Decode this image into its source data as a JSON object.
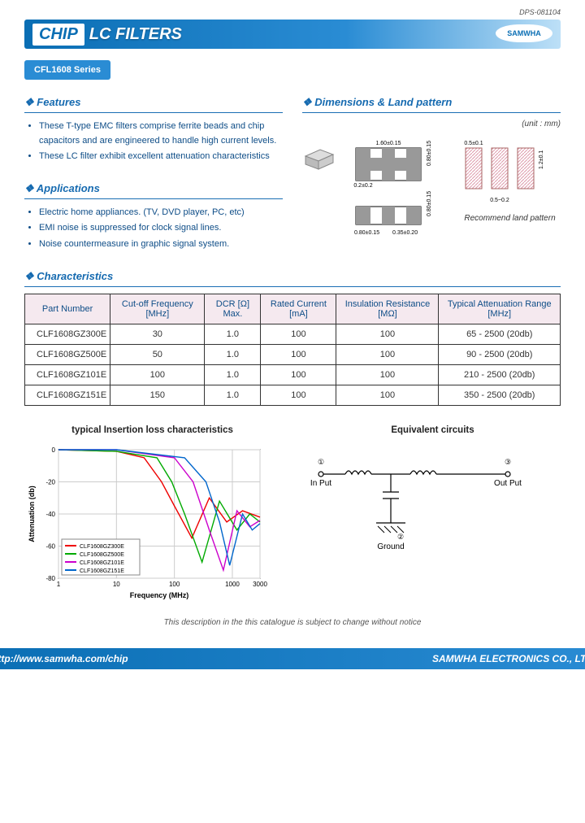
{
  "doc_number": "DPS-081104",
  "header": {
    "chip": "CHIP",
    "title": "LC FILTERS",
    "brand": "SAMWHA"
  },
  "series": "CFL1608 Series",
  "features_title": "Features",
  "features": [
    "These T-type EMC filters comprise ferrite beads and chip capacitors and are engineered to handle high current levels.",
    "These LC filter exhibit excellent attenuation characteristics"
  ],
  "applications_title": "Applications",
  "applications": [
    "Electric home appliances. (TV, DVD player, PC, etc)",
    "EMI noise is suppressed for clock signal lines.",
    "Noise countermeasure in graphic signal system."
  ],
  "dimensions_title": "Dimensions & Land pattern",
  "unit_note": "(unit : mm)",
  "dim_labels": {
    "w": "1.60±0.15",
    "h": "0.80±0.15",
    "t1": "0.2±0.2",
    "pad_w": "0.5±0.1",
    "pad_gap": "0.5~0.2",
    "land_h": "1.2±0.1",
    "bot_w": "0.80±0.15",
    "bot_t": "0.80±0.15",
    "bot_pad": "0.35±0.20"
  },
  "land_caption": "Recommend land pattern",
  "characteristics_title": "Characteristics",
  "table": {
    "headers": [
      "Part Number",
      "Cut-off Frequency [MHz]",
      "DCR [Ω] Max.",
      "Rated Current [mA]",
      "Insulation Resistance [MΩ]",
      "Typical Attenuation Range [MHz]"
    ],
    "rows": [
      [
        "CLF1608GZ300E",
        "30",
        "1.0",
        "100",
        "100",
        "65 - 2500 (20db)"
      ],
      [
        "CLF1608GZ500E",
        "50",
        "1.0",
        "100",
        "100",
        "90 - 2500 (20db)"
      ],
      [
        "CLF1608GZ101E",
        "100",
        "1.0",
        "100",
        "100",
        "210 - 2500 (20db)"
      ],
      [
        "CLF1608GZ151E",
        "150",
        "1.0",
        "100",
        "100",
        "350 - 2500 (20db)"
      ]
    ]
  },
  "chart_title": "typical Insertion loss characteristics",
  "eq_title": "Equivalent circuits",
  "eq_labels": {
    "in": "In Put",
    "out": "Out Put",
    "gnd": "Ground",
    "n1": "①",
    "n2": "②",
    "n3": "③"
  },
  "chart_data": {
    "type": "line",
    "xlabel": "Frequency (MHz)",
    "ylabel": "Attenuation (db)",
    "xscale": "log",
    "xlim": [
      1,
      3000
    ],
    "ylim": [
      -80,
      0
    ],
    "xticks": [
      1,
      10,
      100,
      1000,
      3000
    ],
    "yticks": [
      0,
      -20,
      -40,
      -60,
      -80
    ],
    "series": [
      {
        "name": "CLF1608GZ300E",
        "color": "#e00",
        "x": [
          1,
          10,
          30,
          60,
          100,
          200,
          400,
          800,
          1500,
          3000
        ],
        "y": [
          0,
          -1,
          -5,
          -20,
          -35,
          -55,
          -30,
          -45,
          -38,
          -42
        ]
      },
      {
        "name": "CLF1608GZ500E",
        "color": "#0a0",
        "x": [
          1,
          10,
          50,
          90,
          150,
          300,
          600,
          1200,
          2000,
          3000
        ],
        "y": [
          0,
          -1,
          -5,
          -20,
          -40,
          -70,
          -32,
          -50,
          -40,
          -45
        ]
      },
      {
        "name": "CLF1608GZ101E",
        "color": "#c0c",
        "x": [
          1,
          10,
          100,
          210,
          400,
          700,
          1200,
          2000,
          3000
        ],
        "y": [
          0,
          0,
          -5,
          -20,
          -50,
          -75,
          -38,
          -48,
          -44
        ]
      },
      {
        "name": "CLF1608GZ151E",
        "color": "#06c",
        "x": [
          1,
          10,
          150,
          350,
          600,
          900,
          1500,
          2200,
          3000
        ],
        "y": [
          0,
          0,
          -5,
          -20,
          -45,
          -72,
          -40,
          -50,
          -46
        ]
      }
    ]
  },
  "footer_note": "This description in the this catalogue is subject to change without notice",
  "footer": {
    "url": "http://www.samwha.com/chip",
    "company": "SAMWHA ELECTRONICS CO., LTD"
  }
}
